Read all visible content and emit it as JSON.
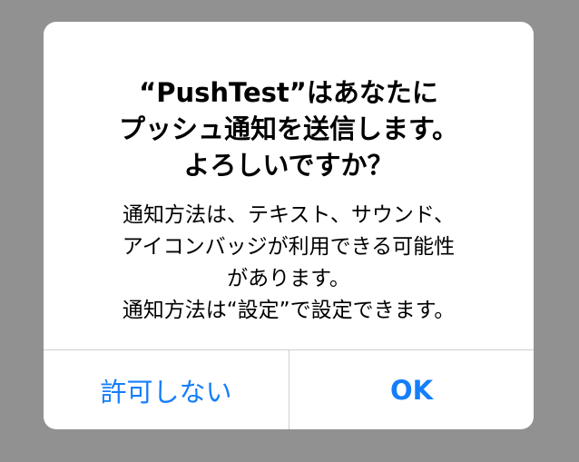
{
  "alert": {
    "title_lines": [
      "“PushTest”はあなたに",
      "プッシュ通知を送信します。",
      "よろしいですか？"
    ],
    "message_lines": [
      "通知方法は、テキスト、サウンド、",
      "アイコンバッジが利用できる可能性",
      "があります。",
      "通知方法は“設定”で設定できます。"
    ],
    "buttons": {
      "deny_label": "許可しない",
      "ok_label": "OK"
    }
  },
  "colors": {
    "backdrop": "#919191",
    "alert_background": "#ffffff",
    "button_text": "#157efb",
    "divider": "#cfcfd3"
  }
}
